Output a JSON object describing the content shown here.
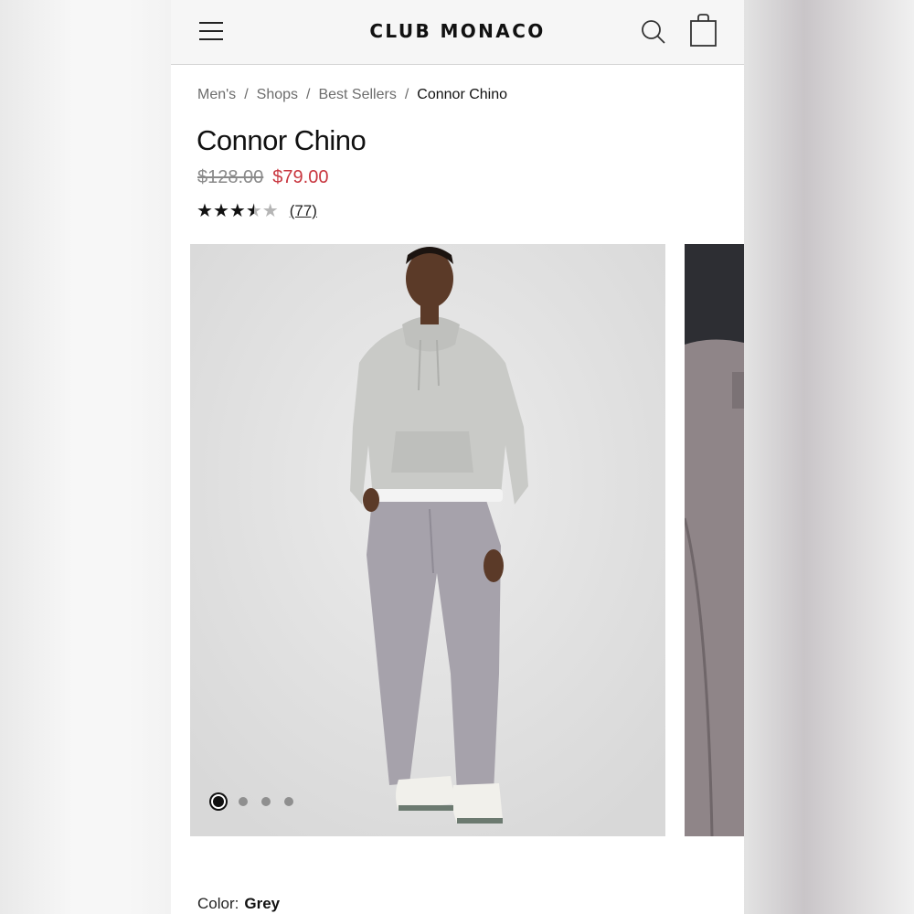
{
  "header": {
    "brand": "CLUB MONACO",
    "menu_icon": "hamburger-menu-icon",
    "search_icon": "search-icon",
    "bag_icon": "shopping-bag-icon"
  },
  "breadcrumb": [
    "Men's",
    "Shops",
    "Best Sellers",
    "Connor Chino"
  ],
  "product": {
    "title": "Connor Chino",
    "price_original": "$128.00",
    "price_sale": "$79.00",
    "rating": 3.5,
    "rating_max": 5,
    "review_count": "(77)",
    "color_label": "Color:",
    "color_value": "Grey"
  },
  "gallery": {
    "image_count": 4,
    "active_index": 0
  },
  "colors": {
    "sale_price": "#c8363f",
    "header_bg": "#f6f6f6",
    "pants": "#a6a2ab",
    "hoodie": "#c9cac7"
  }
}
